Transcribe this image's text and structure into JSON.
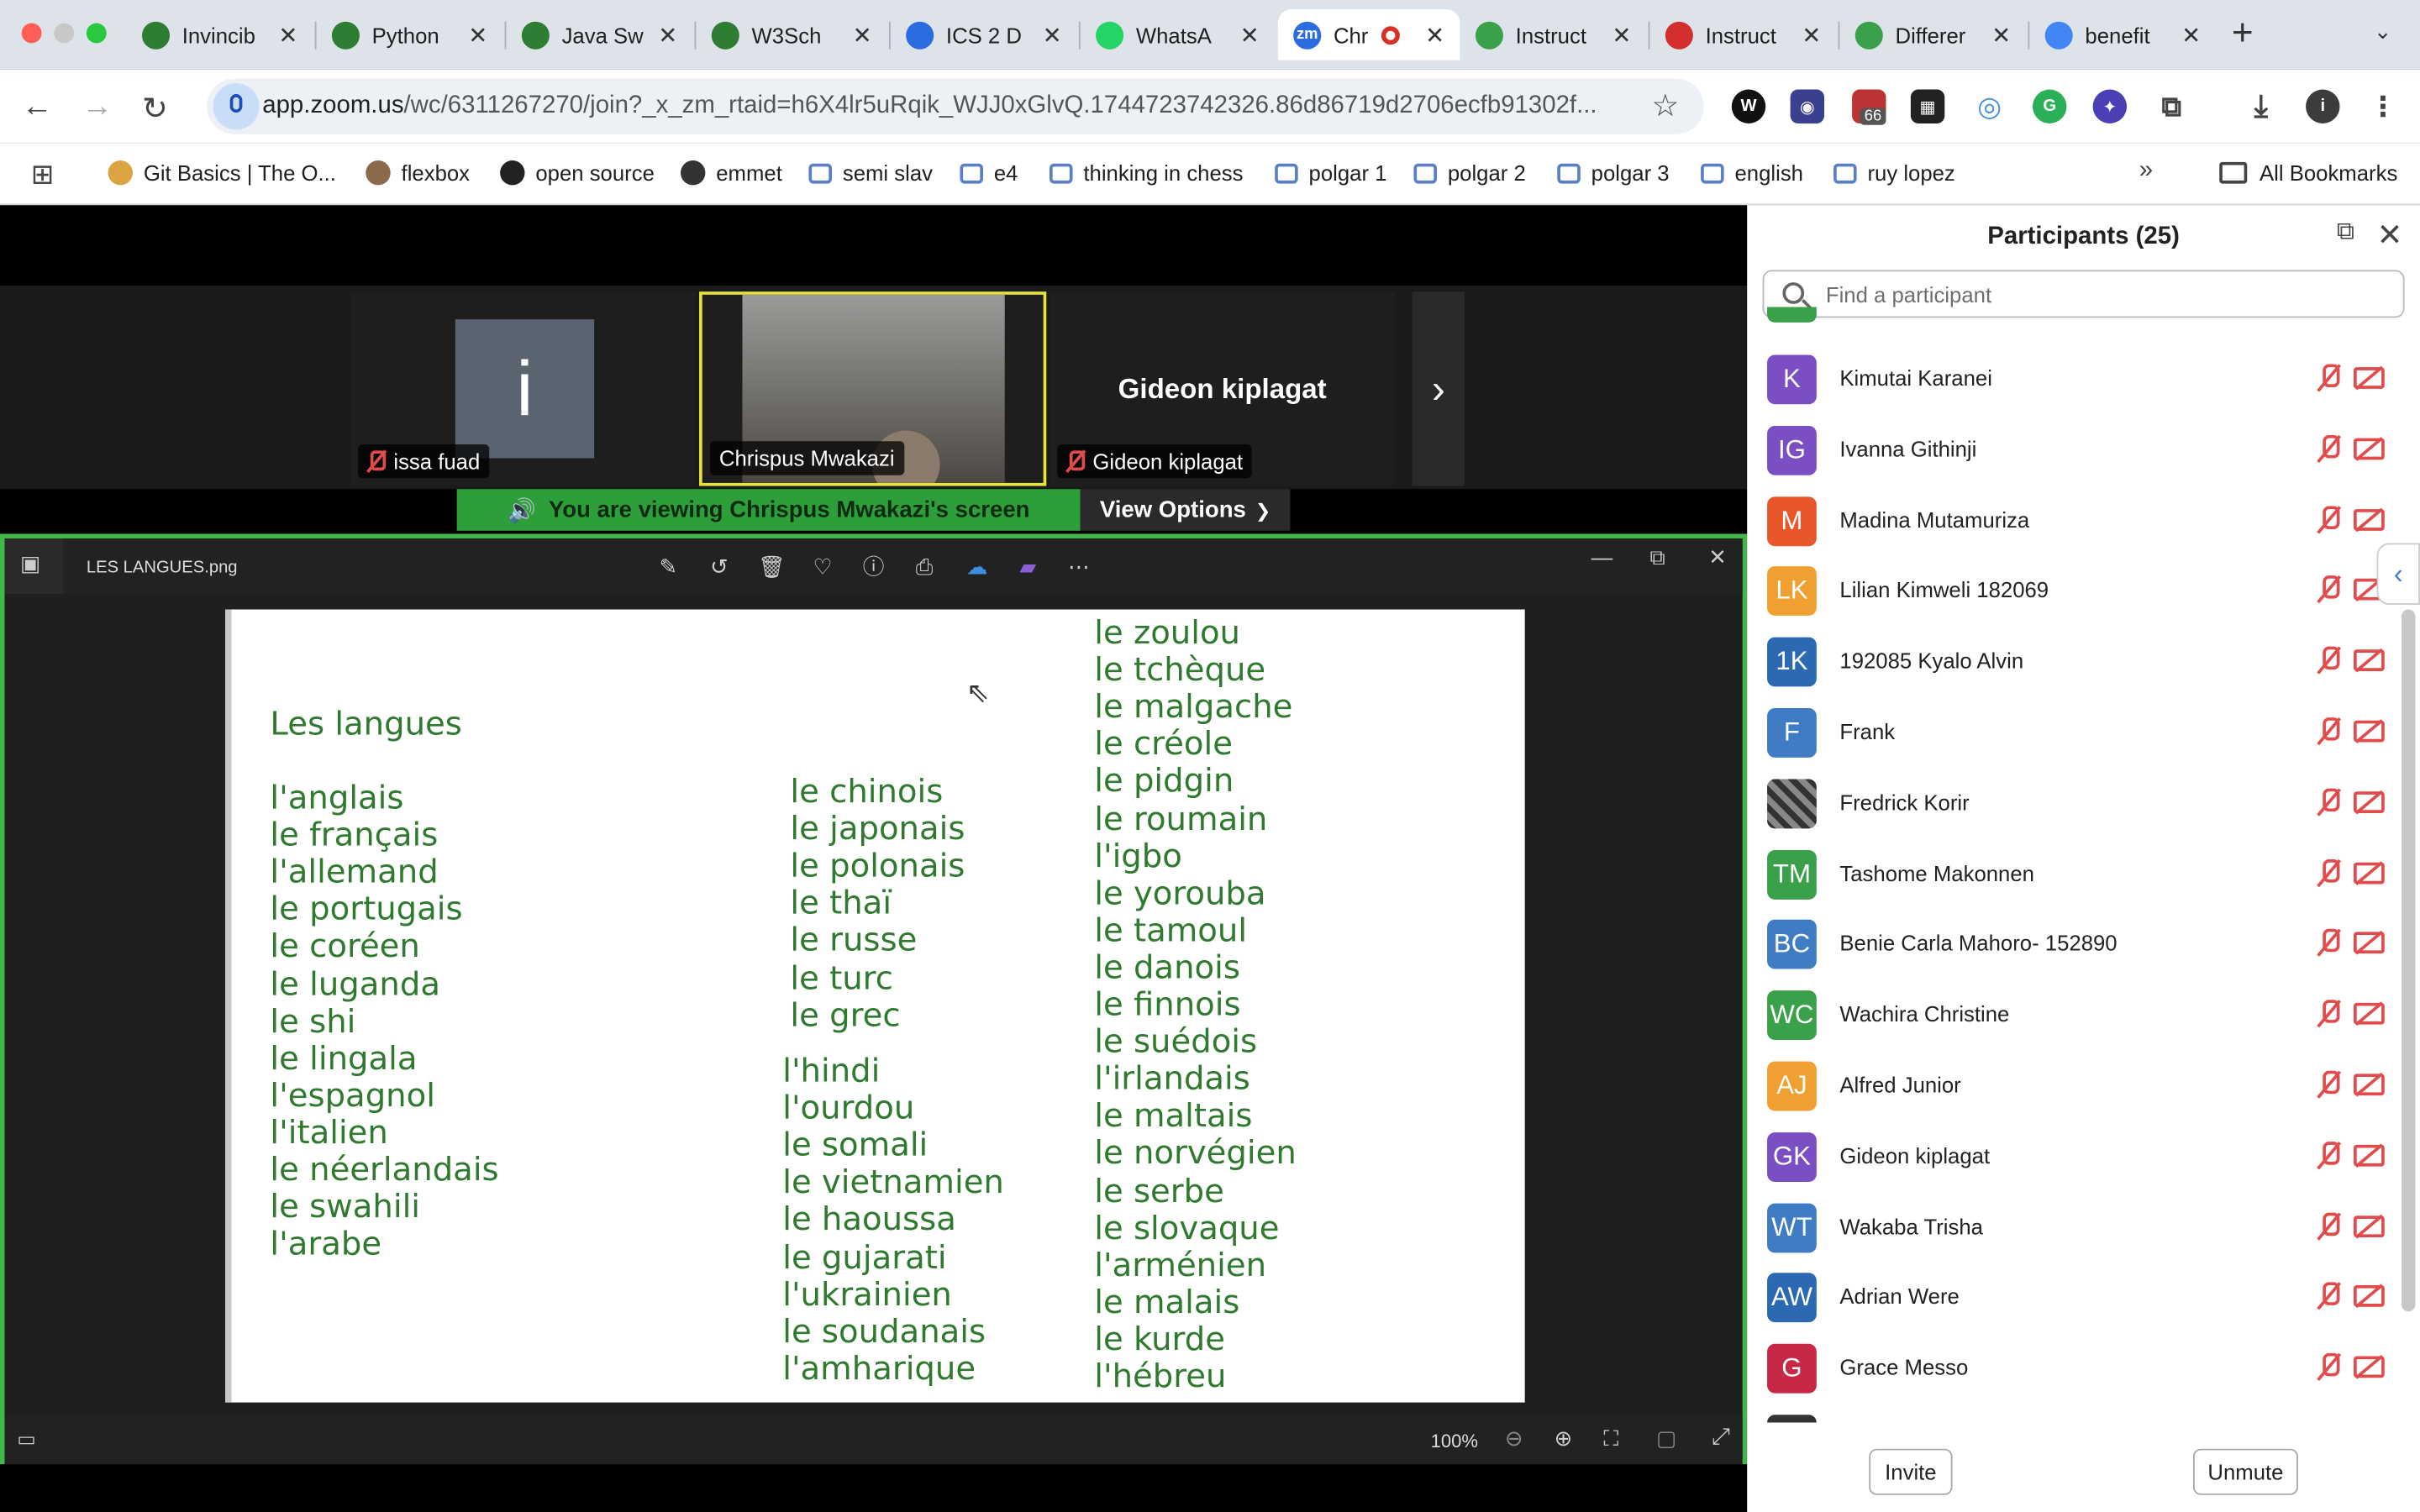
{
  "browser": {
    "tabs": [
      {
        "title": "Invincib",
        "color": "#2e7d32"
      },
      {
        "title": "Python",
        "color": "#2e7d32"
      },
      {
        "title": "Java Sw",
        "color": "#2e7d32"
      },
      {
        "title": "W3Sch",
        "color": "#2e7d32"
      },
      {
        "title": "ICS 2 D",
        "color": "#2b6de0"
      },
      {
        "title": "WhatsA",
        "color": "#25d366"
      },
      {
        "title": "Chr",
        "color": "#2b6de0"
      },
      {
        "title": "Instruct",
        "color": "#3aa04a"
      },
      {
        "title": "Instruct",
        "color": "#d32f2f"
      },
      {
        "title": "Differer",
        "color": "#3aa04a"
      },
      {
        "title": "benefit",
        "color": "#4285f4"
      }
    ],
    "url_host": "app.zoom.us",
    "url_path": "/wc/6311267270/join?_x_zm_rtaid=h6X4lr5uRqik_WJJ0xGlvQ.1744723742326.86d86719d2706ecfb91302f...",
    "extension_badge": "66",
    "bookmarks": [
      "Git Basics | The O...",
      "flexbox",
      "open source",
      "emmet",
      "semi slav",
      "e4",
      "thinking in chess",
      "polgar 1",
      "polgar 2",
      "polgar 3",
      "english",
      "ruy lopez"
    ],
    "all_bookmarks": "All Bookmarks"
  },
  "meeting": {
    "videos": [
      {
        "name": "issa fuad",
        "initial": "i"
      },
      {
        "name": "Chrispus Mwakazi"
      },
      {
        "name": "Gideon kiplagat",
        "center_label": "Gideon kiplagat"
      }
    ],
    "banner": "You are viewing  Chrispus Mwakazi's screen",
    "view_options": "View Options",
    "viewer": {
      "filename": "LES LANGUES.png",
      "zoom": "100%"
    },
    "slide": {
      "title": "Les langues",
      "col1": [
        "l'anglais",
        "le français",
        "l'allemand",
        "le portugais",
        "le coréen",
        "le luganda",
        "le shi",
        "le lingala",
        "l'espagnol",
        "l'italien",
        "le néerlandais",
        "le swahili",
        "l'arabe"
      ],
      "col2a": [
        "le chinois",
        "le japonais",
        "le polonais",
        "le thaï",
        "le russe",
        "le turc",
        "le grec"
      ],
      "col2b": [
        "l'hindi",
        "l'ourdou",
        "le somali",
        "le vietnamien",
        "le haoussa",
        "le gujarati",
        "l'ukrainien",
        "le soudanais",
        "l'amharique"
      ],
      "col3": [
        "le zoulou",
        "le tchèque",
        "le malgache",
        "le créole",
        "le pidgin",
        "le roumain",
        "l'igbo",
        "le yorouba",
        "le tamoul",
        "le danois",
        "le finnois",
        "le suédois",
        "l'irlandais",
        "le maltais",
        "le norvégien",
        "le serbe",
        "le slovaque",
        "l'arménien",
        "le malais",
        "le kurde",
        "l'hébreu"
      ]
    }
  },
  "participants": {
    "title": "Participants (25)",
    "search_placeholder": "Find a participant",
    "list": [
      {
        "name": "Kimutai Karanei",
        "initials": "K",
        "color": "#7a4fc4"
      },
      {
        "name": "Ivanna Githinji",
        "initials": "IG",
        "color": "#7a4fc4"
      },
      {
        "name": "Madina Mutamuriza",
        "initials": "M",
        "color": "#e8572a"
      },
      {
        "name": "Lilian Kimweli 182069",
        "initials": "LK",
        "color": "#f0a030"
      },
      {
        "name": "192085 Kyalo Alvin",
        "initials": "1K",
        "color": "#2b6ab3"
      },
      {
        "name": "Frank",
        "initials": "F",
        "color": "#3f7cc4"
      },
      {
        "name": "Fredrick Korir",
        "initials": "",
        "color": "#5a5a5a"
      },
      {
        "name": "Tashome Makonnen",
        "initials": "TM",
        "color": "#3aa04a"
      },
      {
        "name": "Benie Carla Mahoro- 152890",
        "initials": "BC",
        "color": "#3f7cc4"
      },
      {
        "name": "Wachira Christine",
        "initials": "WC",
        "color": "#3aa04a"
      },
      {
        "name": "Alfred Junior",
        "initials": "AJ",
        "color": "#f0a030"
      },
      {
        "name": "Gideon kiplagat",
        "initials": "GK",
        "color": "#7a4fc4"
      },
      {
        "name": "Wakaba Trisha",
        "initials": "WT",
        "color": "#3f7cc4"
      },
      {
        "name": "Adrian Were",
        "initials": "AW",
        "color": "#2b6ab3"
      },
      {
        "name": "Grace Messo",
        "initials": "G",
        "color": "#c62845"
      }
    ],
    "invite": "Invite",
    "unmute": "Unmute"
  }
}
